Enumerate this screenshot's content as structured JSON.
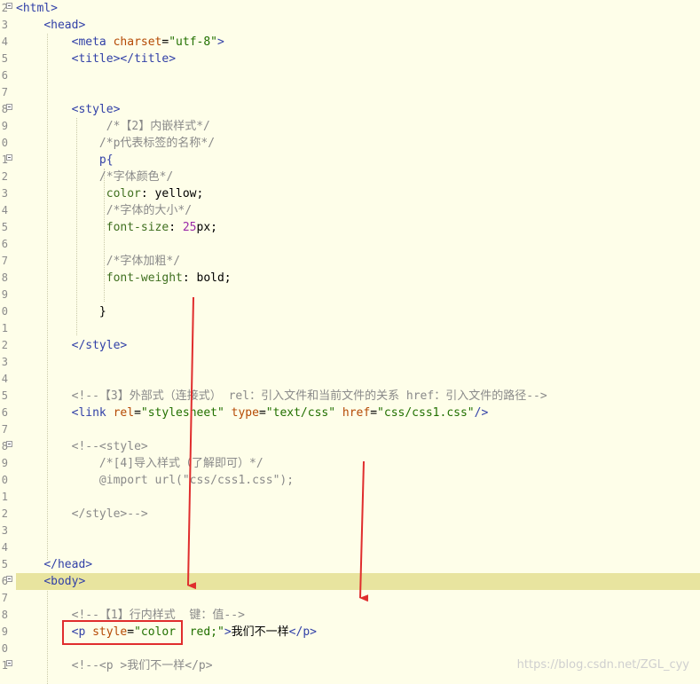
{
  "editor": {
    "line_numbers": [
      "2",
      "3",
      "4",
      "5",
      "6",
      "7",
      "8",
      "9",
      "0",
      "1",
      "2",
      "3",
      "4",
      "5",
      "6",
      "7",
      "8",
      "9",
      "0",
      "1",
      "2",
      "3",
      "4",
      "5",
      "6",
      "7",
      "8",
      "9",
      "0",
      "1",
      "2",
      "3",
      "4",
      "5",
      "6",
      "7",
      "8",
      "9",
      "0",
      "1"
    ],
    "lines": {
      "l0": {
        "a": "<html>"
      },
      "l1": {
        "a": "<head>"
      },
      "l2": {
        "a": "<meta ",
        "b": "charset",
        "c": "=",
        "d": "\"utf-8\"",
        "e": ">"
      },
      "l3": {
        "a": "<title></title>"
      },
      "l6": {
        "a": "<style>"
      },
      "l7": {
        "a": "/*【2】内嵌样式*/"
      },
      "l8": {
        "a": "/*p代表标签的名称*/"
      },
      "l9": {
        "a": "p{"
      },
      "l10": {
        "a": "/*字体颜色*/"
      },
      "l11": {
        "a": "color",
        "b": ": ",
        "c": "yellow;"
      },
      "l12": {
        "a": "/*字体的大小*/"
      },
      "l13": {
        "a": "font-size",
        "b": ": ",
        "c": "25",
        "d": "px;"
      },
      "l15": {
        "a": "/*字体加粗*/"
      },
      "l16": {
        "a": "font-weight",
        "b": ": ",
        "c": "bold;"
      },
      "l18": {
        "a": "}"
      },
      "l20": {
        "a": "</style>"
      },
      "l23": {
        "a": "<!--【3】外部式（连接式） rel：引入文件和当前文件的关系 href：引入文件的路径-->"
      },
      "l24": {
        "a": "<link ",
        "b": "rel",
        "c": "=",
        "d": "\"stylesheet\"",
        "e": " type",
        "f": "=",
        "g": "\"text/css\"",
        "h": " href",
        "i": "=",
        "j": "\"css/css1.css\"",
        "k": "/>"
      },
      "l26": {
        "a": "<!--<style>"
      },
      "l27": {
        "a": "/*[4]导入样式（了解即可）*/"
      },
      "l28": {
        "a": "@import url(\"css/css1.css\");"
      },
      "l30": {
        "a": "</style>-->"
      },
      "l33": {
        "a": "</head>"
      },
      "l34": {
        "a": "<body>"
      },
      "l36": {
        "a": "<!--【1】行内样式  键：值-->"
      },
      "l37": {
        "a": "<p ",
        "b": "style",
        "c": "=",
        "d": "\"color  red;\"",
        "e": ">",
        "f": "我们不一样",
        "g": "</p>"
      },
      "l39": {
        "a": "<!--<p >我们不一样</p>"
      }
    }
  },
  "watermark": "https://blog.csdn.net/ZGL_cyy",
  "colors": {
    "tag": "#3140a7",
    "attribute": "#b54a05",
    "string": "#217000",
    "comment": "#8a8a8a",
    "highlight_line": "#e8e49f",
    "annotation": "#e02d2d"
  }
}
